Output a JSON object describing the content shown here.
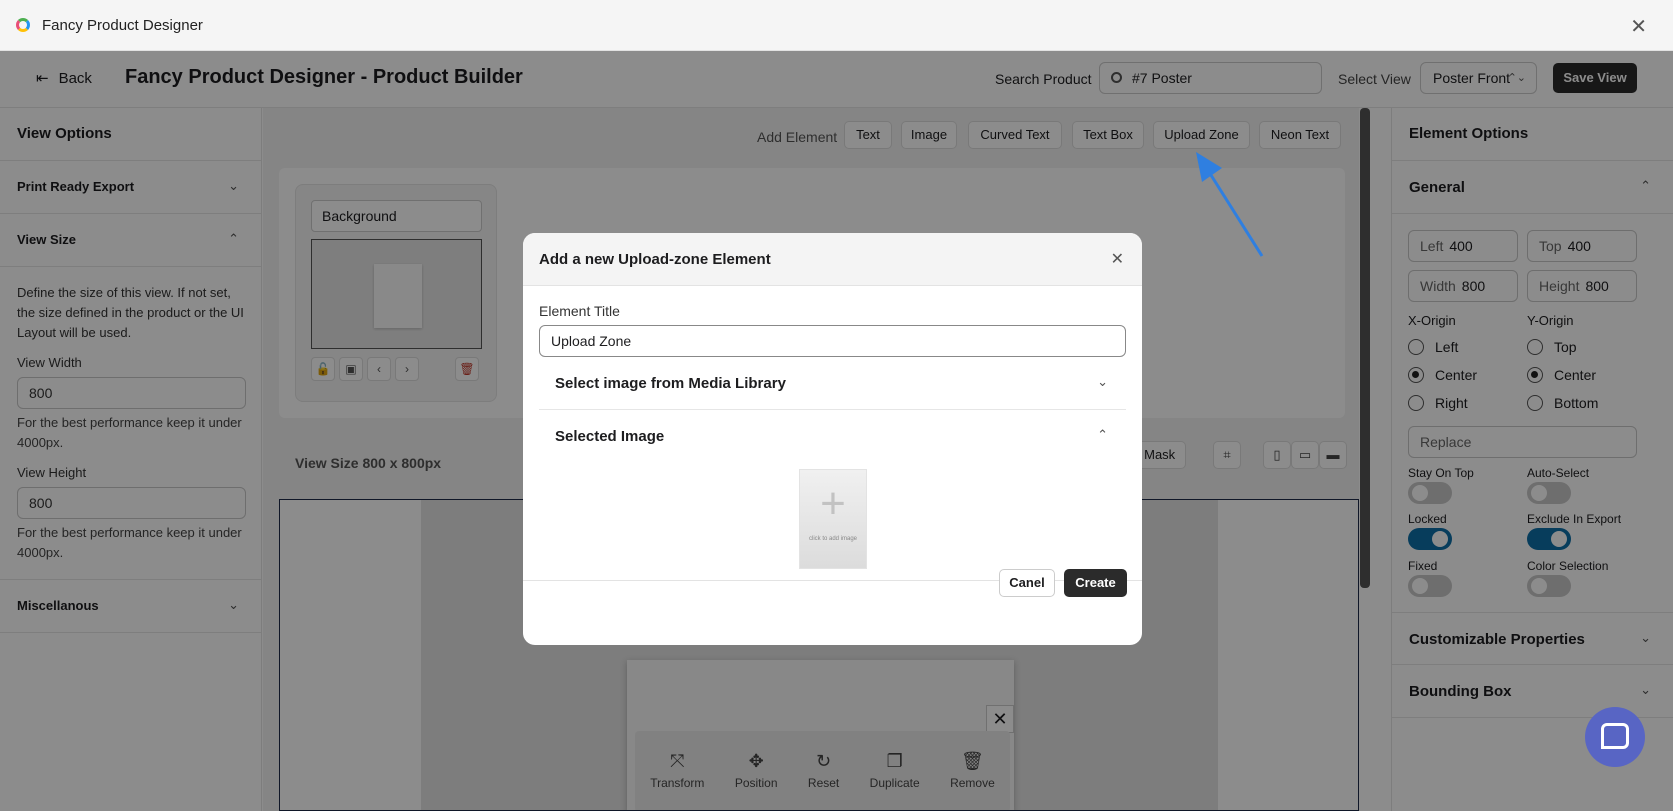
{
  "window": {
    "title": "Fancy Product Designer"
  },
  "header": {
    "back_label": "Back",
    "title": "Fancy Product Designer - Product Builder",
    "search_label": "Search Product",
    "search_value": "#7 Poster",
    "view_label": "Select View",
    "view_value": "Poster Front",
    "save_label": "Save View"
  },
  "left_panel": {
    "title": "View Options",
    "print_export": "Print Ready Export",
    "view_size": "View Size",
    "view_size_desc": "Define the size of this view. If not set, the size defined in the product or the UI Layout will be used.",
    "width_label": "View Width",
    "width_value": "800",
    "width_hint": "For the best performance keep it under 4000px.",
    "height_label": "View Height",
    "height_value": "800",
    "height_hint": "For the best performance keep it under 4000px.",
    "misc": "Miscellanous"
  },
  "center": {
    "add_label": "Add Element",
    "add_buttons": [
      "Text",
      "Image",
      "Curved Text",
      "Text Box",
      "Upload Zone",
      "Neon Text"
    ],
    "layer_name": "Background",
    "view_size_text": "View Size 800 x 800px",
    "mask_btn": "s Mask",
    "tools": [
      "Transform",
      "Position",
      "Reset",
      "Duplicate",
      "Remove"
    ]
  },
  "right_panel": {
    "title": "Element Options",
    "general": "General",
    "left_lbl": "Left",
    "left_val": "400",
    "top_lbl": "Top",
    "top_val": "400",
    "width_lbl": "Width",
    "width_val": "800",
    "height_lbl": "Height",
    "height_val": "800",
    "x_origin": "X-Origin",
    "y_origin": "Y-Origin",
    "x_opts": [
      "Left",
      "Center",
      "Right"
    ],
    "y_opts": [
      "Top",
      "Center",
      "Bottom"
    ],
    "replace_placeholder": "Replace",
    "stay_on_top": "Stay On Top",
    "auto_select": "Auto-Select",
    "locked": "Locked",
    "exclude_export": "Exclude In Export",
    "fixed": "Fixed",
    "color_selection": "Color Selection",
    "customizable": "Customizable Properties",
    "bounding_box": "Bounding Box"
  },
  "modal": {
    "title": "Add a new Upload-zone Element",
    "element_title_label": "Element Title",
    "element_title_value": "Upload Zone",
    "media_library": "Select image from Media Library",
    "selected_image": "Selected Image",
    "placeholder_text": "click to add image",
    "cancel_label": "Canel",
    "create_label": "Create"
  },
  "colors": {
    "accent": "#0e6fa8",
    "dark_button": "#2b2b2b",
    "help_bubble": "#5865c4",
    "arrow": "#2f7fe0"
  }
}
